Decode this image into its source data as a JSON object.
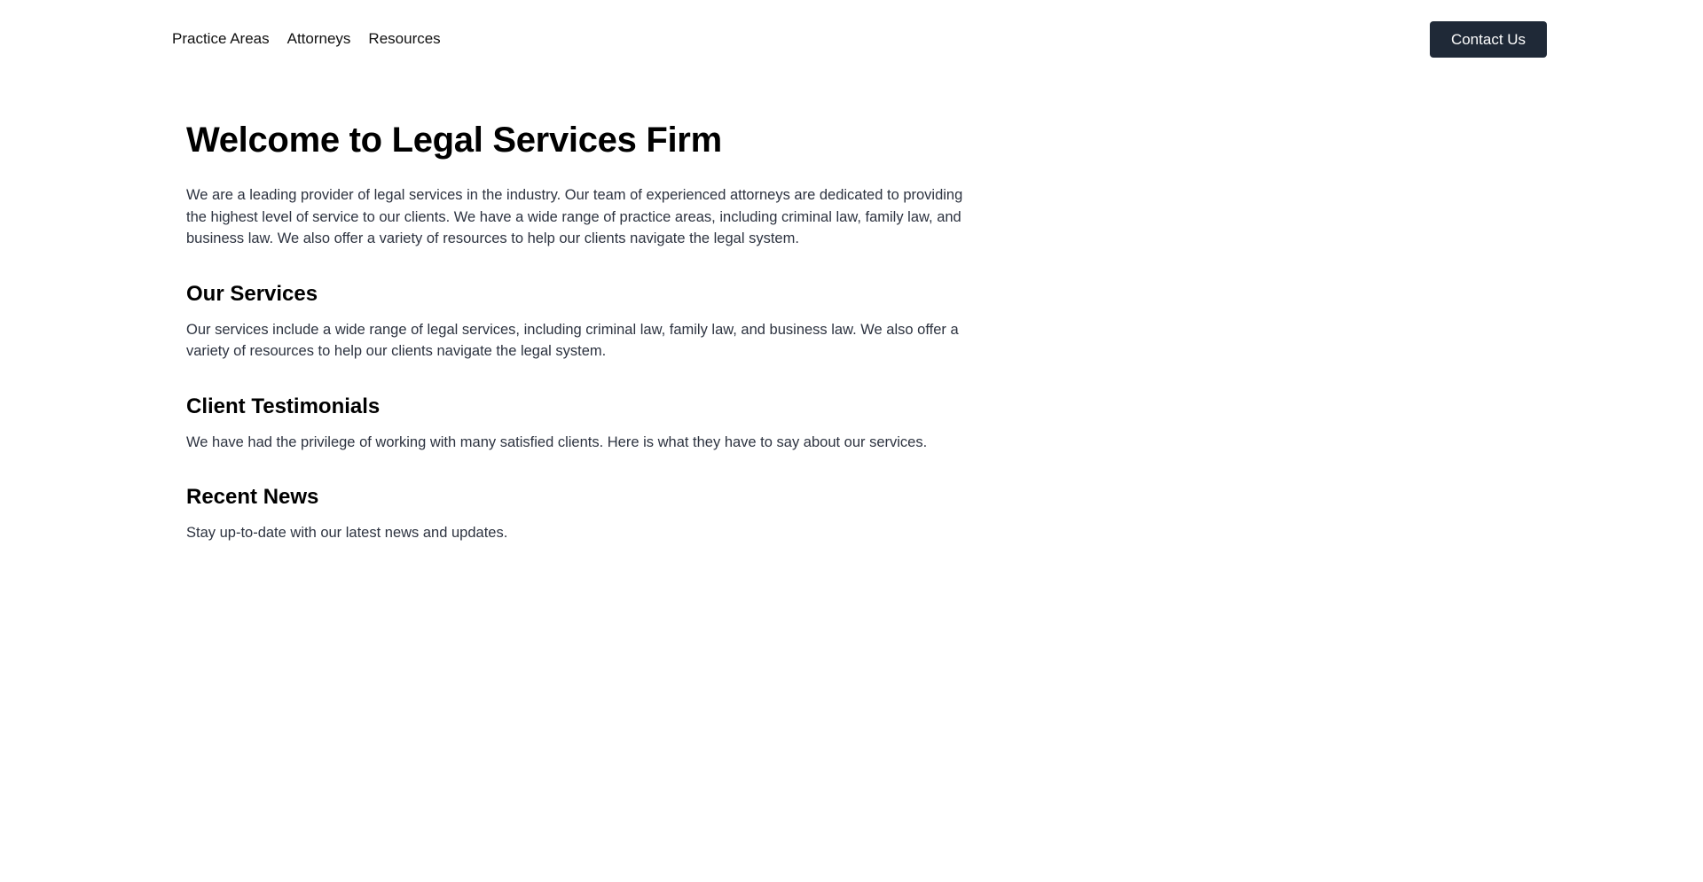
{
  "nav": {
    "items": [
      {
        "label": "Practice Areas"
      },
      {
        "label": "Attorneys"
      },
      {
        "label": "Resources"
      }
    ],
    "contact_label": "Contact Us"
  },
  "hero": {
    "title": "Welcome to Legal Services Firm",
    "intro": "We are a leading provider of legal services in the industry. Our team of experienced attorneys are dedicated to providing the highest level of service to our clients. We have a wide range of practice areas, including criminal law, family law, and business law. We also offer a variety of resources to help our clients navigate the legal system."
  },
  "sections": [
    {
      "title": "Our Services",
      "text": "Our services include a wide range of legal services, including criminal law, family law, and business law. We also offer a variety of resources to help our clients navigate the legal system."
    },
    {
      "title": "Client Testimonials",
      "text": "We have had the privilege of working with many satisfied clients. Here is what they have to say about our services."
    },
    {
      "title": "Recent News",
      "text": "Stay up-to-date with our latest news and updates."
    }
  ],
  "colors": {
    "button_bg": "#1f2937",
    "button_text": "#ffffff",
    "body_text": "#2d3340",
    "heading_text": "#000000"
  }
}
